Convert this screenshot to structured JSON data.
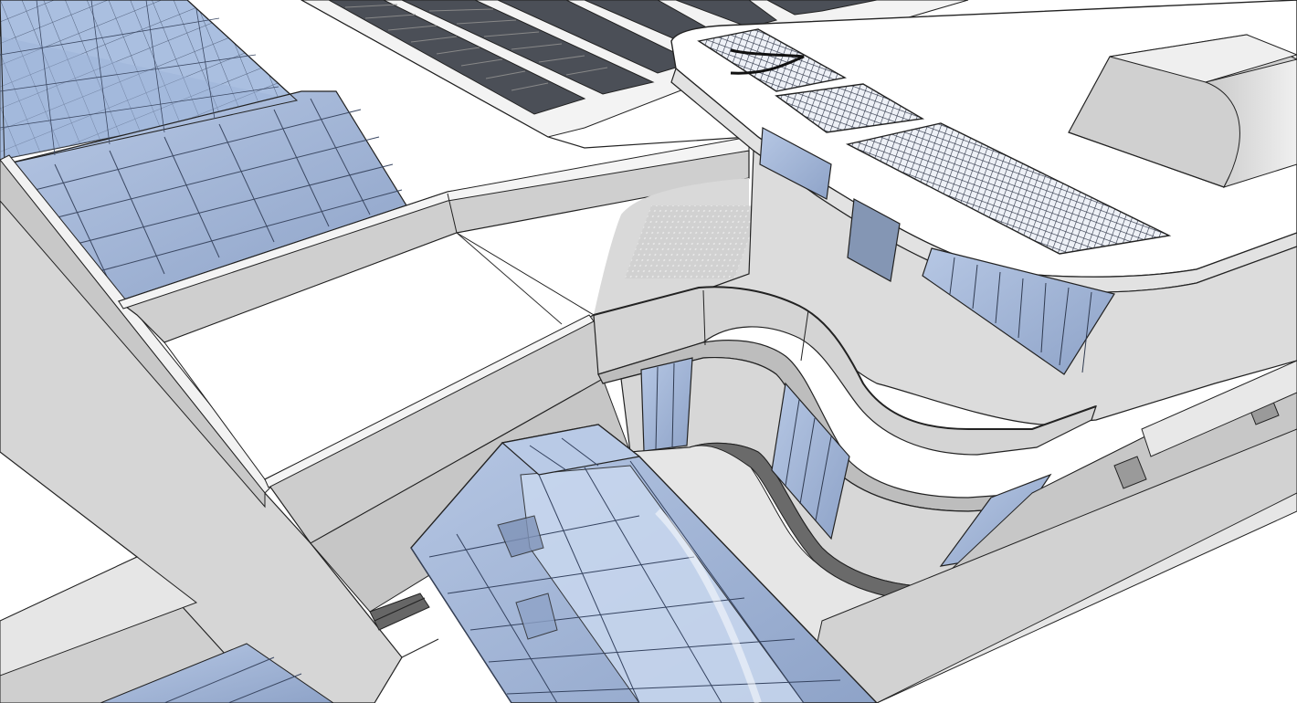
{
  "scene": {
    "view": "3d-model-perspective",
    "style": "hidden-line-shaded",
    "colors": {
      "sky_ground": "#ffffff",
      "wall_light": "#e4e4e4",
      "wall_mid": "#d3d3d3",
      "wall_shade": "#b9b9b9",
      "wall_dark": "#9c9c9c",
      "glass": "#a8bddd",
      "glass_light": "#c9d8ef",
      "glass_dark": "#7d93b8",
      "solar_panel": "#555a66",
      "edge": "#1a1a1a"
    }
  }
}
